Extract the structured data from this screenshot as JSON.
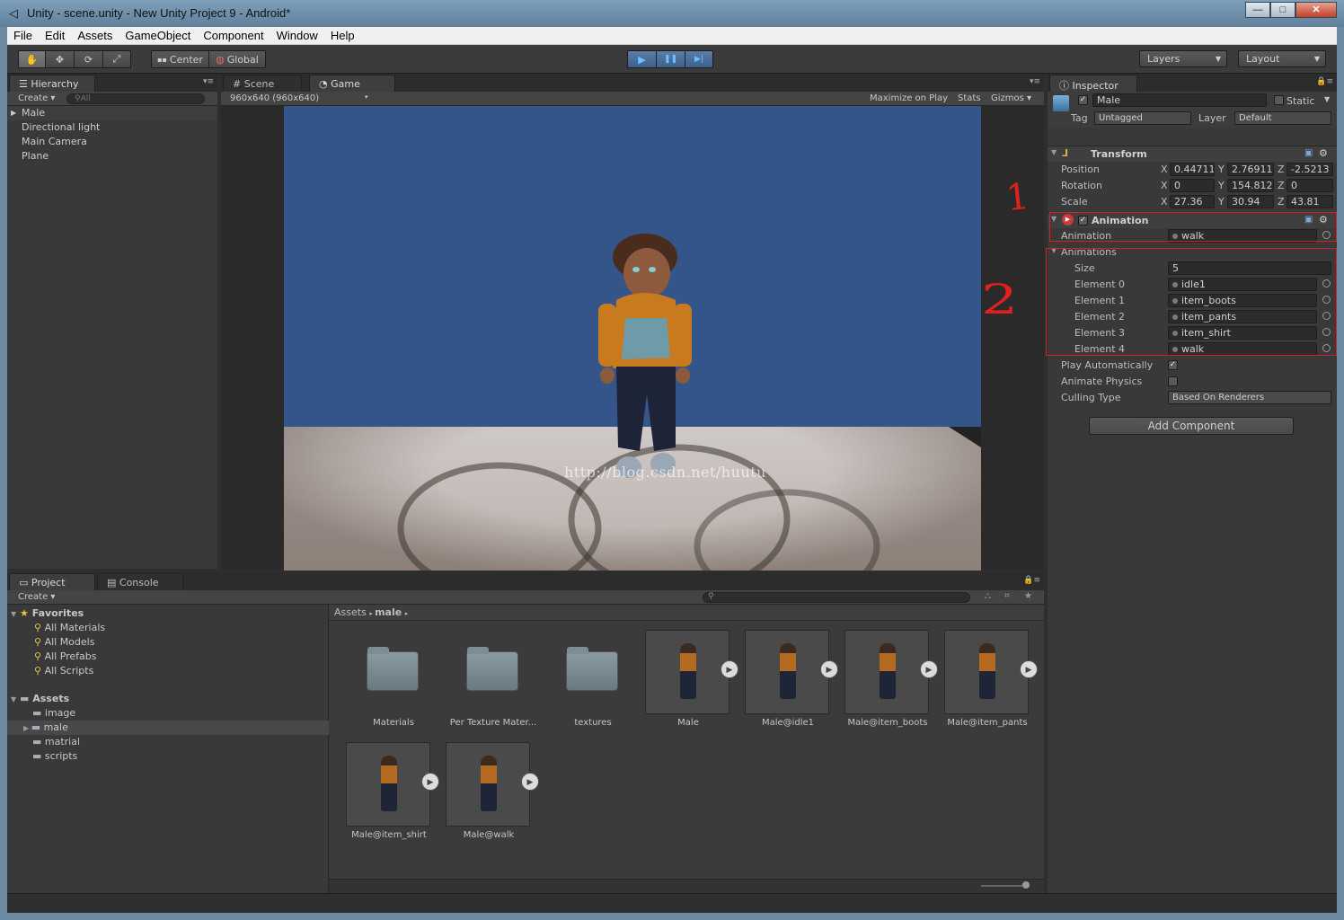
{
  "window": {
    "title": "Unity - scene.unity - New Unity Project 9 - Android*",
    "min": "—",
    "max": "□",
    "close": "✕"
  },
  "menu": [
    "File",
    "Edit",
    "Assets",
    "GameObject",
    "Component",
    "Window",
    "Help"
  ],
  "toolbar": {
    "tools": [
      "✋",
      "✥",
      "⟳",
      "⤢"
    ],
    "pivot": "Center",
    "space": "Global",
    "play": "▶",
    "pause": "❚❚",
    "step": "▶|",
    "layers": "Layers",
    "layout": "Layout"
  },
  "hierarchy": {
    "tab": "Hierarchy",
    "create": "Create",
    "search": "All",
    "items": [
      "Male",
      "Directional light",
      "Main Camera",
      "Plane"
    ]
  },
  "sceneTabs": {
    "scene": "Scene",
    "game": "Game"
  },
  "game": {
    "resolution": "960x640 (960x640)",
    "maximize": "Maximize on Play",
    "stats": "Stats",
    "gizmos": "Gizmos",
    "watermark": "http://blog.csdn.net/huutu"
  },
  "inspector": {
    "tab": "Inspector",
    "objectName": "Male",
    "static": "Static",
    "tagLabel": "Tag",
    "tag": "Untagged",
    "layerLabel": "Layer",
    "layer": "Default",
    "transform": {
      "title": "Transform",
      "position": {
        "label": "Position",
        "x": "0.44711",
        "y": "2.76911",
        "z": "-2.5213"
      },
      "rotation": {
        "label": "Rotation",
        "x": "0",
        "y": "154.812",
        "z": "0"
      },
      "scale": {
        "label": "Scale",
        "x": "27.36",
        "y": "30.94",
        "z": "43.81"
      },
      "axisX": "X",
      "axisY": "Y",
      "axisZ": "Z"
    },
    "animation": {
      "title": "Animation",
      "animLabel": "Animation",
      "anim": "walk",
      "animationsLabel": "Animations",
      "sizeLabel": "Size",
      "size": "5",
      "elements": [
        {
          "label": "Element 0",
          "value": "idle1"
        },
        {
          "label": "Element 1",
          "value": "item_boots"
        },
        {
          "label": "Element 2",
          "value": "item_pants"
        },
        {
          "label": "Element 3",
          "value": "item_shirt"
        },
        {
          "label": "Element 4",
          "value": "walk"
        }
      ],
      "playAuto": "Play Automatically",
      "animPhysics": "Animate Physics",
      "cullingLabel": "Culling Type",
      "culling": "Based On Renderers"
    },
    "addComponent": "Add Component",
    "annotations": {
      "one": "1",
      "two": "2"
    }
  },
  "project": {
    "tab": "Project",
    "consoleTab": "Console",
    "create": "Create",
    "favorites": "Favorites",
    "favItems": [
      "All Materials",
      "All Models",
      "All Prefabs",
      "All Scripts"
    ],
    "assets": "Assets",
    "assetFolders": [
      "image",
      "male",
      "matrial",
      "scripts"
    ],
    "crumb": {
      "root": "Assets",
      "sub": "male"
    },
    "grid": [
      {
        "name": "Materials",
        "kind": "folder"
      },
      {
        "name": "Per Texture Mater...",
        "kind": "folder"
      },
      {
        "name": "textures",
        "kind": "folder"
      },
      {
        "name": "Male",
        "kind": "model"
      },
      {
        "name": "Male@idle1",
        "kind": "model"
      },
      {
        "name": "Male@item_boots",
        "kind": "model"
      },
      {
        "name": "Male@item_pants",
        "kind": "model"
      },
      {
        "name": "Male@item_shirt",
        "kind": "model"
      },
      {
        "name": "Male@walk",
        "kind": "model"
      }
    ]
  }
}
